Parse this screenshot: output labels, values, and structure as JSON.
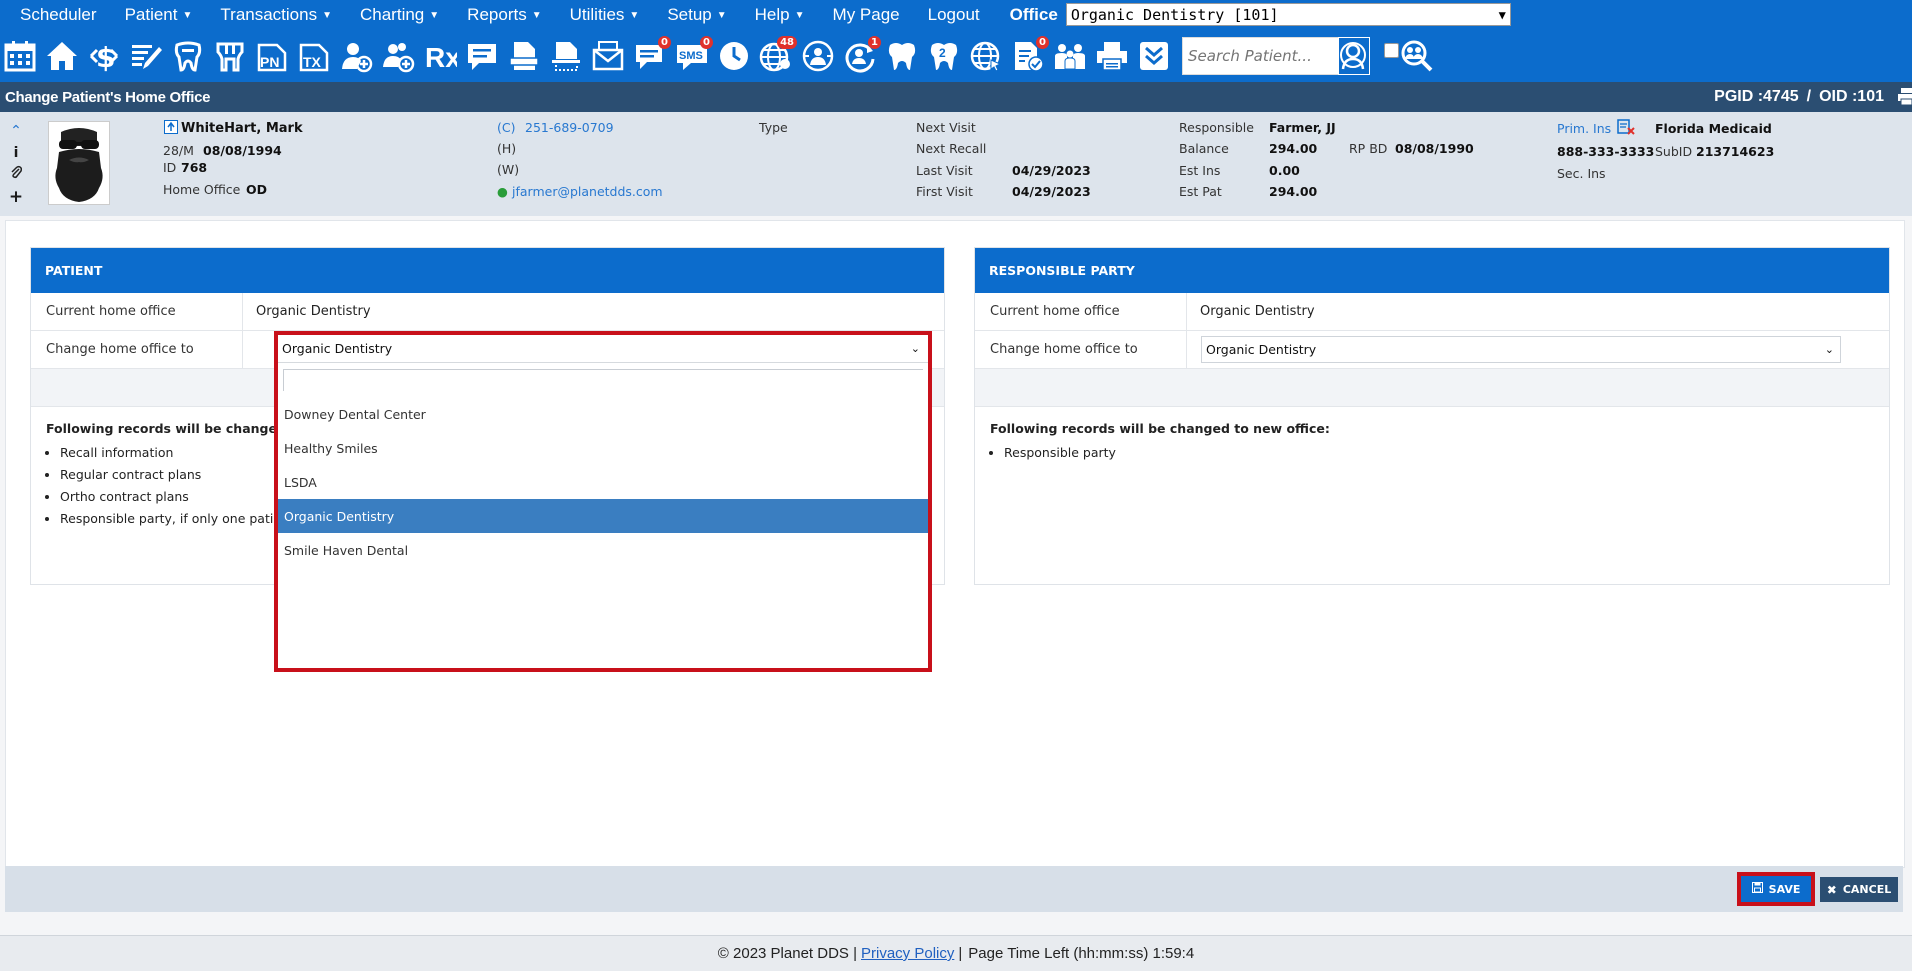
{
  "nav": {
    "items": [
      {
        "label": "Scheduler",
        "caret": false
      },
      {
        "label": "Patient",
        "caret": true
      },
      {
        "label": "Transactions",
        "caret": true
      },
      {
        "label": "Charting",
        "caret": true
      },
      {
        "label": "Reports",
        "caret": true
      },
      {
        "label": "Utilities",
        "caret": true
      },
      {
        "label": "Setup",
        "caret": true
      },
      {
        "label": "Help",
        "caret": true
      },
      {
        "label": "My Page",
        "caret": false
      },
      {
        "label": "Logout",
        "caret": false
      }
    ],
    "office_label": "Office",
    "office_value": "Organic Dentistry [101]"
  },
  "toolbar": {
    "icons": [
      "calendar-icon",
      "home-icon",
      "ledger-icon",
      "notes-icon",
      "tooth-chart-icon",
      "perio-icon",
      "progress-notes-icon",
      "treatment-icon",
      "add-patient-icon",
      "add-family-icon",
      "rx-icon",
      "message-icon",
      "document-icon",
      "scan-icon",
      "email-icon",
      "chat-icon",
      "sms-icon",
      "clock-icon",
      "globe-icon",
      "world-people-icon",
      "recall-icon",
      "tooth-icon",
      "tooth-2-icon",
      "web-icon",
      "checklist-icon",
      "family-icon",
      "print-icon",
      "expand-icon"
    ],
    "pn_text": "PN",
    "tx_text": "TX",
    "sms_text": "SMS",
    "rx_text": "Rx",
    "tooth2_text": "2",
    "badges": {
      "chat": "0",
      "sms": "0",
      "globe": "48",
      "recall": "1",
      "checklist": "0"
    },
    "search_placeholder": "Search Patient..."
  },
  "titlebar": {
    "title": "Change Patient's Home Office",
    "pgid": "PGID :4745",
    "oid": "OID :101",
    "separator": "/"
  },
  "patient": {
    "name": "WhiteHart, Mark",
    "age_sex": "28/M",
    "dob": "08/08/1994",
    "id_label": "ID",
    "id": "768",
    "home_office_label": "Home Office",
    "home_office": "OD",
    "phone_c_label": "(C)",
    "phone_c": "251-689-0709",
    "phone_h_label": "(H)",
    "phone_w_label": "(W)",
    "email": "jfarmer@planetdds.com",
    "type_label": "Type",
    "next_visit_label": "Next Visit",
    "next_recall_label": "Next Recall",
    "last_visit_label": "Last Visit",
    "last_visit": "04/29/2023",
    "first_visit_label": "First Visit",
    "first_visit": "04/29/2023",
    "responsible_label": "Responsible",
    "responsible": "Farmer, JJ",
    "balance_label": "Balance",
    "balance": "294.00",
    "rp_bd_label": "RP BD",
    "rp_bd": "08/08/1990",
    "est_ins_label": "Est Ins",
    "est_ins": "0.00",
    "est_pat_label": "Est Pat",
    "est_pat": "294.00",
    "prim_ins_label": "Prim. Ins",
    "prim_ins": "Florida Medicaid",
    "ins_phone": "888-333-3333",
    "subid_label": "SubID",
    "subid": "213714623",
    "sec_ins_label": "Sec. Ins"
  },
  "patient_panel": {
    "heading": "PATIENT",
    "current_label": "Current home office",
    "current_value": "Organic Dentistry",
    "change_label": "Change home office to",
    "change_value": "Organic Dentistry",
    "note_title": "Following records will be changed to n",
    "note_items": [
      "Recall information",
      "Regular contract plans",
      "Ortho contract plans",
      "Responsible party, if only one patien"
    ]
  },
  "rp_panel": {
    "heading": "RESPONSIBLE PARTY",
    "current_label": "Current home office",
    "current_value": "Organic Dentistry",
    "change_label": "Change home office to",
    "change_value": "Organic Dentistry",
    "note_title": "Following records will be changed to new office:",
    "note_items": [
      "Responsible party"
    ]
  },
  "dropdown": {
    "selected": "Organic Dentistry",
    "search_value": "",
    "options": [
      "Downey Dental Center",
      "Healthy Smiles",
      "LSDA",
      "Organic Dentistry",
      "Smile Haven Dental"
    ],
    "active_index": 3
  },
  "buttons": {
    "save": "SAVE",
    "cancel": "CANCEL"
  },
  "footer": {
    "copyright": "© 2023 Planet DDS |",
    "privacy": "Privacy Policy",
    "sep": "|",
    "time_left": "Page Time Left (hh:mm:ss) 1:59:4"
  },
  "colors": {
    "brand": "#0c6ccc",
    "title_bar": "#2b4e72",
    "highlight": "#c8101a",
    "active_option": "#3a7ec1"
  }
}
